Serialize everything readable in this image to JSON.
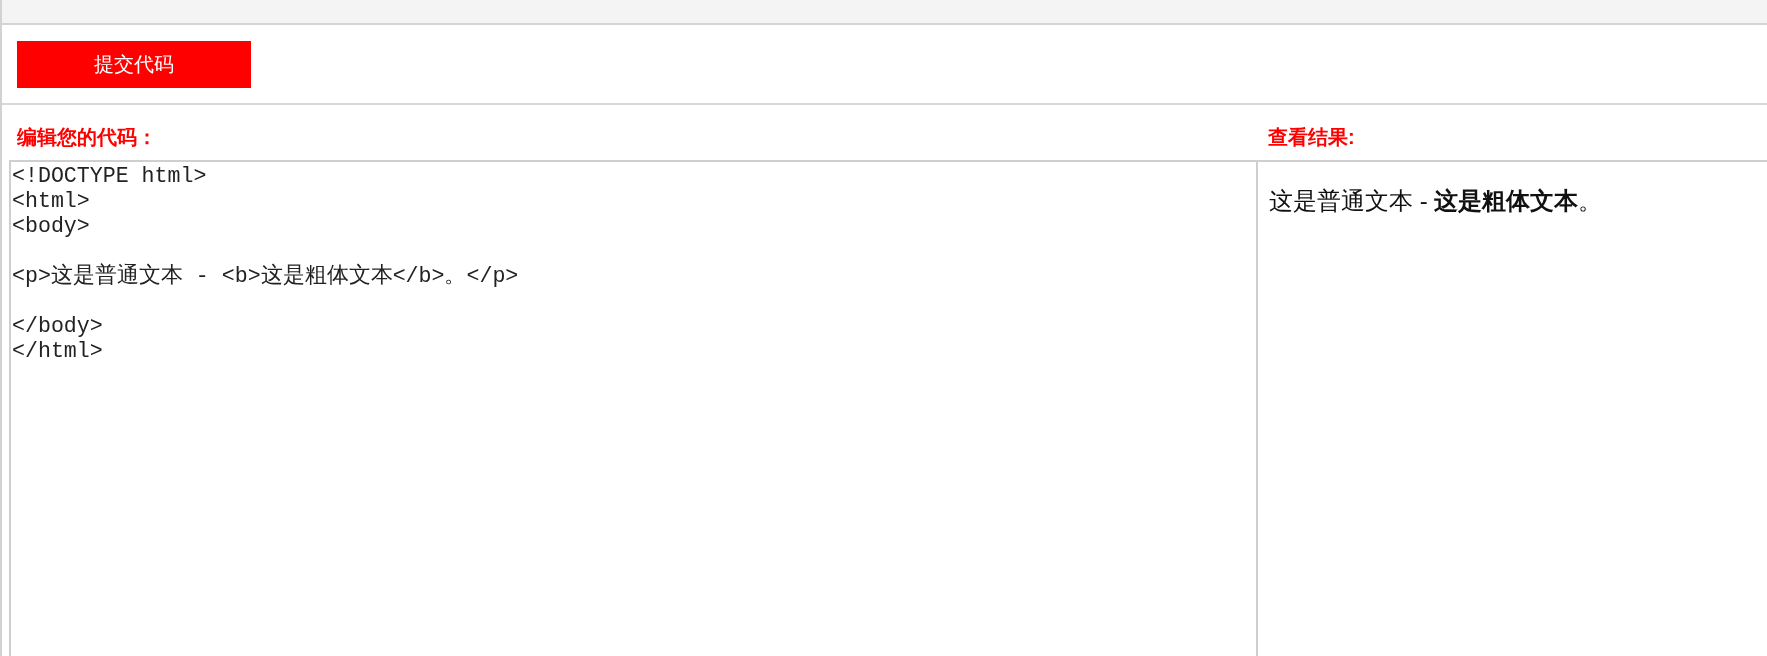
{
  "toolbar": {
    "submit_button": {
      "label": "提交代码"
    }
  },
  "editor": {
    "label": "编辑您的代码：",
    "code": "<!DOCTYPE html>\n<html>\n<body>\n\n<p>这是普通文本 - <b>这是粗体文本</b>。</p>\n\n</body>\n</html>"
  },
  "result": {
    "label": "查看结果:",
    "text": "这是普通文本 - **这是粗体文本**。"
  }
}
